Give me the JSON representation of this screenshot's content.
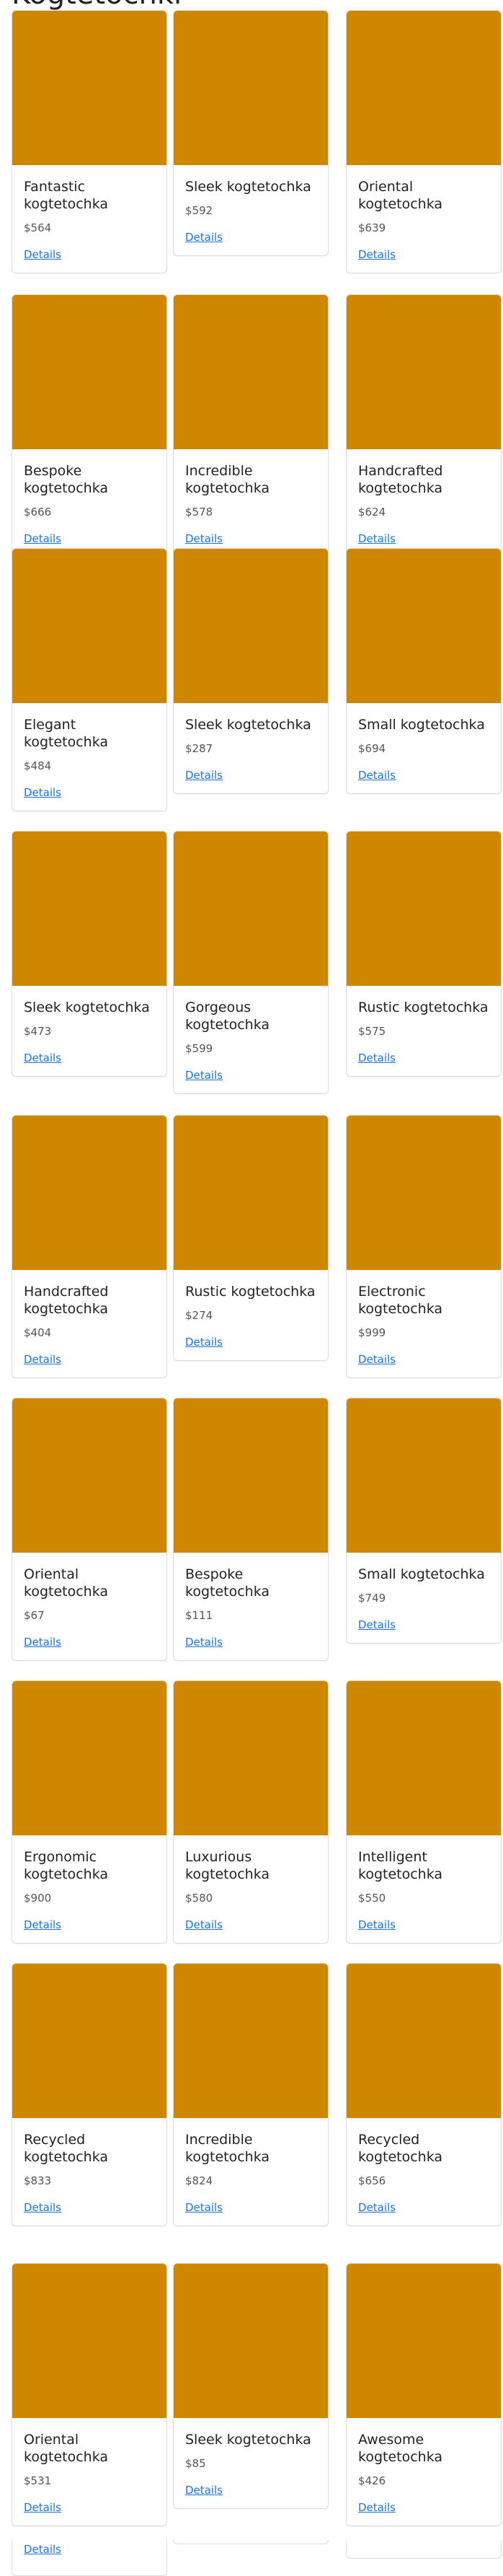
{
  "page": {
    "title": "Kogtetochki"
  },
  "link_label": "Details",
  "image_color": "#d08700",
  "rows": [
    [
      {
        "name": "Fantastic kogtetochka",
        "price": "$564"
      },
      {
        "name": "Sleek kogtetochka",
        "price": "$592"
      },
      {
        "name": "Oriental kogtetochka",
        "price": "$639"
      }
    ],
    [
      {
        "name": "Bespoke kogtetochka",
        "price": "$666"
      },
      {
        "name": "Incredible kogtetochka",
        "price": "$578"
      },
      {
        "name": "Handcrafted kogtetochka",
        "price": "$624"
      }
    ],
    [
      {
        "name": "Elegant kogtetochka",
        "price": "$484"
      },
      {
        "name": "Sleek kogtetochka",
        "price": "$287"
      },
      {
        "name": "Small kogtetochka",
        "price": "$694"
      }
    ],
    [
      {
        "name": "Sleek kogtetochka",
        "price": "$473"
      },
      {
        "name": "Gorgeous kogtetochka",
        "price": "$599"
      },
      {
        "name": "Rustic kogtetochka",
        "price": "$575"
      }
    ],
    [
      {
        "name": "Handcrafted kogtetochka",
        "price": "$404"
      },
      {
        "name": "Rustic kogtetochka",
        "price": "$274"
      },
      {
        "name": "Electronic kogtetochka",
        "price": "$999"
      }
    ],
    [
      {
        "name": "Oriental kogtetochka",
        "price": "$67"
      },
      {
        "name": "Bespoke kogtetochka",
        "price": "$111"
      },
      {
        "name": "Small kogtetochka",
        "price": "$749"
      }
    ],
    [
      {
        "name": "Ergonomic kogtetochka",
        "price": "$900"
      },
      {
        "name": "Luxurious kogtetochka",
        "price": "$580"
      },
      {
        "name": "Intelligent kogtetochka",
        "price": "$550"
      }
    ],
    [
      {
        "name": "Recycled kogtetochka",
        "price": "$833"
      },
      {
        "name": "Incredible kogtetochka",
        "price": "$824"
      },
      {
        "name": "Recycled kogtetochka",
        "price": "$656"
      }
    ],
    [
      {
        "name": "Oriental kogtetochka",
        "price": "$531"
      },
      {
        "name": "Sleek kogtetochka",
        "price": "$85"
      },
      {
        "name": "Awesome kogtetochka",
        "price": "$426"
      }
    ]
  ]
}
